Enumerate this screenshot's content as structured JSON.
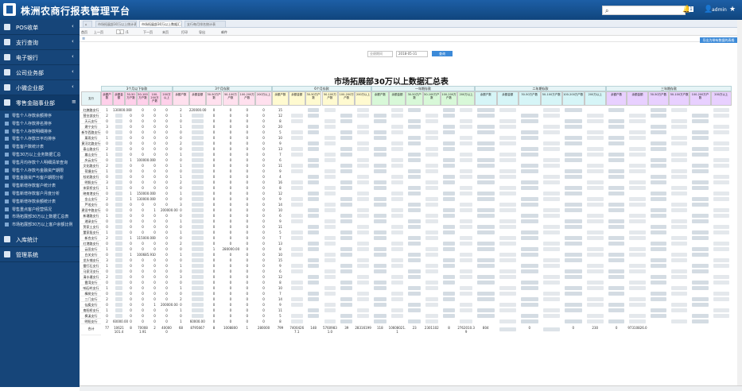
{
  "header": {
    "title": "株洲农商行报表管理平台",
    "search_placeholder": "",
    "user": "admin",
    "badge": "1"
  },
  "sidebar": {
    "items": [
      {
        "label": "POS收单"
      },
      {
        "label": "支行查询"
      },
      {
        "label": "电子银行"
      },
      {
        "label": "公司业务部"
      },
      {
        "label": "小微企业部"
      },
      {
        "label": "零售金融事业部"
      }
    ],
    "subitems": [
      "零售个人存款余额排序",
      "零售个人存款排名排序",
      "零售个人存款明细排序",
      "零售个人存款日平均排序",
      "零售客户数统计表",
      "零售30万以上业务数据汇总",
      "零售月均存款个人明细清单查询",
      "零售个人存款与金融资产期限",
      "零售金融资产与客户期限分析",
      "零售新增存款客户统计表",
      "零售新增存款客户月度分析",
      "零售新增存款余额统计表",
      "零售重点客户经营情况",
      "市场拓展部30万以上数据汇总表",
      "市场拓展部30万以上客户余额比例"
    ],
    "items2": [
      {
        "label": "入库统计"
      },
      {
        "label": "管理系统"
      }
    ]
  },
  "tabs": [
    "市场拓展部30万以上统计表",
    "市场拓展部30万以上数据汇总表",
    "支行每月排名统计表"
  ],
  "toolbar": {
    "first": "首页",
    "prev": "上一页",
    "page": "1",
    "total": "/1",
    "next": "下一页",
    "last": "末页",
    "print": "打印",
    "export": "导出",
    "email": "邮件"
  },
  "section": "市场拓展部30万以上数据汇总表",
  "export_button": "导出为带有数据的表格",
  "filter": {
    "label": "业绩期间",
    "date": "2018-05-31",
    "query": "查询"
  },
  "report": {
    "title": "市场拓展部30万以上数据汇总表",
    "groups": [
      "3个月以下存款",
      "3个月存款",
      "6个月存款",
      "一年期存款",
      "二年期存款",
      "三年期存款"
    ],
    "row_header": "支行",
    "total_label": "合计",
    "total_values": [
      "77",
      "10621101.4",
      "8",
      "700081.91",
      "2",
      "400000",
      "68",
      "8795667",
      "8",
      "1008800",
      "1",
      "280000",
      "799",
      "74004267.1",
      "148",
      "57609831.0",
      "39",
      "28316199",
      "118",
      "10608021.1",
      "23",
      "2301102",
      "8",
      "2762010.39",
      "804",
      "",
      "0",
      "",
      "0",
      "230",
      "0",
      "97310826.0"
    ],
    "rows": [
      {
        "name": "红旗路支行",
        "v": [
          "1",
          "130000.00",
          "0",
          "0",
          "0",
          "0",
          "2",
          "220000.00",
          "0",
          "0",
          "0",
          "0",
          "15"
        ]
      },
      {
        "name": "营业部支行",
        "v": [
          "2",
          "",
          "0",
          "0",
          "0",
          "0",
          "1",
          "",
          "0",
          "0",
          "0",
          "0",
          "12"
        ]
      },
      {
        "name": "天元支行",
        "v": [
          "0",
          "",
          "0",
          "0",
          "0",
          "0",
          "0",
          "",
          "0",
          "0",
          "0",
          "0",
          "8"
        ]
      },
      {
        "name": "建宁支行",
        "v": [
          "3",
          "",
          "0",
          "0",
          "0",
          "0",
          "1",
          "",
          "0",
          "0",
          "0",
          "0",
          "20"
        ]
      },
      {
        "name": "新华西路支行",
        "v": [
          "0",
          "",
          "0",
          "0",
          "0",
          "0",
          "0",
          "",
          "0",
          "0",
          "0",
          "0",
          "5"
        ]
      },
      {
        "name": "栗雨支行",
        "v": [
          "1",
          "",
          "0",
          "0",
          "0",
          "0",
          "0",
          "",
          "0",
          "0",
          "0",
          "0",
          "10"
        ]
      },
      {
        "name": "黄河北路支行",
        "v": [
          "0",
          "",
          "0",
          "0",
          "0",
          "0",
          "2",
          "",
          "0",
          "0",
          "0",
          "0",
          "9"
        ]
      },
      {
        "name": "泰山路支行",
        "v": [
          "2",
          "",
          "0",
          "0",
          "0",
          "0",
          "0",
          "",
          "0",
          "0",
          "0",
          "0",
          "13"
        ]
      },
      {
        "name": "嵩山支行",
        "v": [
          "1",
          "",
          "0",
          "0",
          "0",
          "0",
          "1",
          "",
          "0",
          "0",
          "0",
          "0",
          "7"
        ]
      },
      {
        "name": "庆云支行",
        "v": [
          "0",
          "",
          "1",
          "100000.00",
          "0",
          "0",
          "0",
          "",
          "0",
          "0",
          "0",
          "0",
          "6"
        ]
      },
      {
        "name": "文化路支行",
        "v": [
          "2",
          "",
          "0",
          "0",
          "0",
          "0",
          "1",
          "",
          "0",
          "0",
          "0",
          "0",
          "11"
        ]
      },
      {
        "name": "荷塘支行",
        "v": [
          "1",
          "",
          "0",
          "0",
          "0",
          "0",
          "0",
          "",
          "0",
          "0",
          "0",
          "0",
          "9"
        ]
      },
      {
        "name": "桂花路支行",
        "v": [
          "0",
          "",
          "0",
          "0",
          "0",
          "0",
          "1",
          "",
          "0",
          "0",
          "0",
          "0",
          "4"
        ]
      },
      {
        "name": "明照支行",
        "v": [
          "3",
          "",
          "0",
          "0",
          "0",
          "0",
          "2",
          "",
          "0",
          "0",
          "0",
          "0",
          "16"
        ]
      },
      {
        "name": "宋家桥支行",
        "v": [
          "1",
          "",
          "0",
          "0",
          "0",
          "0",
          "0",
          "",
          "0",
          "0",
          "0",
          "0",
          "8"
        ]
      },
      {
        "name": "晓南港支行",
        "v": [
          "0",
          "",
          "1",
          "150000.00",
          "0",
          "0",
          "1",
          "",
          "0",
          "0",
          "0",
          "0",
          "12"
        ]
      },
      {
        "name": "金山支行",
        "v": [
          "2",
          "",
          "1",
          "130000.00",
          "0",
          "0",
          "0",
          "",
          "0",
          "0",
          "0",
          "0",
          "9"
        ]
      },
      {
        "name": "芦淞支行",
        "v": [
          "0",
          "",
          "0",
          "0",
          "0",
          "0",
          "3",
          "",
          "0",
          "0",
          "0",
          "0",
          "14"
        ]
      },
      {
        "name": "建设中路支行",
        "v": [
          "0",
          "",
          "0",
          "0",
          "1",
          "200000.00",
          "0",
          "",
          "0",
          "0",
          "0",
          "0",
          "10"
        ]
      },
      {
        "name": "新塘路支行",
        "v": [
          "1",
          "",
          "0",
          "0",
          "0",
          "0",
          "0",
          "",
          "0",
          "0",
          "0",
          "0",
          "6"
        ]
      },
      {
        "name": "湘渌支行",
        "v": [
          "0",
          "",
          "0",
          "0",
          "0",
          "0",
          "1",
          "",
          "0",
          "0",
          "0",
          "0",
          "9"
        ]
      },
      {
        "name": "贺家土支行",
        "v": [
          "0",
          "",
          "0",
          "0",
          "0",
          "0",
          "0",
          "",
          "0",
          "0",
          "0",
          "0",
          "11"
        ]
      },
      {
        "name": "董家段支行",
        "v": [
          "1",
          "",
          "0",
          "0",
          "0",
          "0",
          "1",
          "",
          "0",
          "0",
          "0",
          "0",
          "5"
        ]
      },
      {
        "name": "新合支行",
        "v": [
          "2",
          "",
          "1",
          "115000.00",
          "0",
          "0",
          "0",
          "",
          "0",
          "0",
          "0",
          "0",
          "7"
        ]
      },
      {
        "name": "红港路支行",
        "v": [
          "0",
          "",
          "0",
          "0",
          "0",
          "0",
          "2",
          "",
          "0",
          "0",
          "0",
          "0",
          "13"
        ]
      },
      {
        "name": "云田支行",
        "v": [
          "1",
          "",
          "0",
          "0",
          "0",
          "0",
          "0",
          "",
          "1",
          "280000.00",
          "0",
          "0",
          "8"
        ]
      },
      {
        "name": "白关支行",
        "v": [
          "0",
          "",
          "1",
          "100685.91",
          "0",
          "0",
          "1",
          "",
          "0",
          "0",
          "0",
          "0",
          "10"
        ]
      },
      {
        "name": "龙头铺支行",
        "v": [
          "3",
          "",
          "0",
          "0",
          "0",
          "0",
          "0",
          "",
          "0",
          "0",
          "0",
          "0",
          "15"
        ]
      },
      {
        "name": "雷打石支行",
        "v": [
          "1",
          "",
          "0",
          "0",
          "0",
          "0",
          "1",
          "",
          "0",
          "0",
          "0",
          "0",
          "9"
        ]
      },
      {
        "name": "马家河支行",
        "v": [
          "0",
          "",
          "0",
          "0",
          "0",
          "0",
          "0",
          "",
          "0",
          "0",
          "0",
          "0",
          "6"
        ]
      },
      {
        "name": "清水塘支行",
        "v": [
          "2",
          "",
          "0",
          "0",
          "0",
          "0",
          "3",
          "",
          "0",
          "0",
          "0",
          "0",
          "12"
        ]
      },
      {
        "name": "霞湾支行",
        "v": [
          "0",
          "",
          "0",
          "0",
          "0",
          "0",
          "0",
          "",
          "0",
          "0",
          "0",
          "0",
          "8"
        ]
      },
      {
        "name": "响石岭支行",
        "v": [
          "1",
          "",
          "0",
          "0",
          "0",
          "0",
          "1",
          "",
          "0",
          "0",
          "0",
          "0",
          "10"
        ]
      },
      {
        "name": "樟树支行",
        "v": [
          "0",
          "",
          "0",
          "0",
          "0",
          "0",
          "0",
          "",
          "0",
          "0",
          "0",
          "0",
          "7"
        ]
      },
      {
        "name": "三门支行",
        "v": [
          "2",
          "",
          "0",
          "0",
          "0",
          "0",
          "2",
          "",
          "0",
          "0",
          "0",
          "0",
          "14"
        ]
      },
      {
        "name": "仙庾支行",
        "v": [
          "0",
          "",
          "0",
          "0",
          "1",
          "200000.00",
          "0",
          "",
          "0",
          "0",
          "0",
          "0",
          "9"
        ]
      },
      {
        "name": "南阳桥支行",
        "v": [
          "1",
          "",
          "0",
          "0",
          "0",
          "0",
          "1",
          "",
          "0",
          "0",
          "0",
          "0",
          "11"
        ]
      },
      {
        "name": "枫溪支行",
        "v": [
          "0",
          "",
          "0",
          "0",
          "0",
          "0",
          "0",
          "",
          "0",
          "0",
          "0",
          "0",
          "5"
        ]
      },
      {
        "name": "明阳支行",
        "v": [
          "2",
          "60000.00",
          "0",
          "0",
          "0",
          "0",
          "1",
          "60000.00",
          "0",
          "0",
          "0",
          "0",
          "8"
        ]
      }
    ]
  }
}
